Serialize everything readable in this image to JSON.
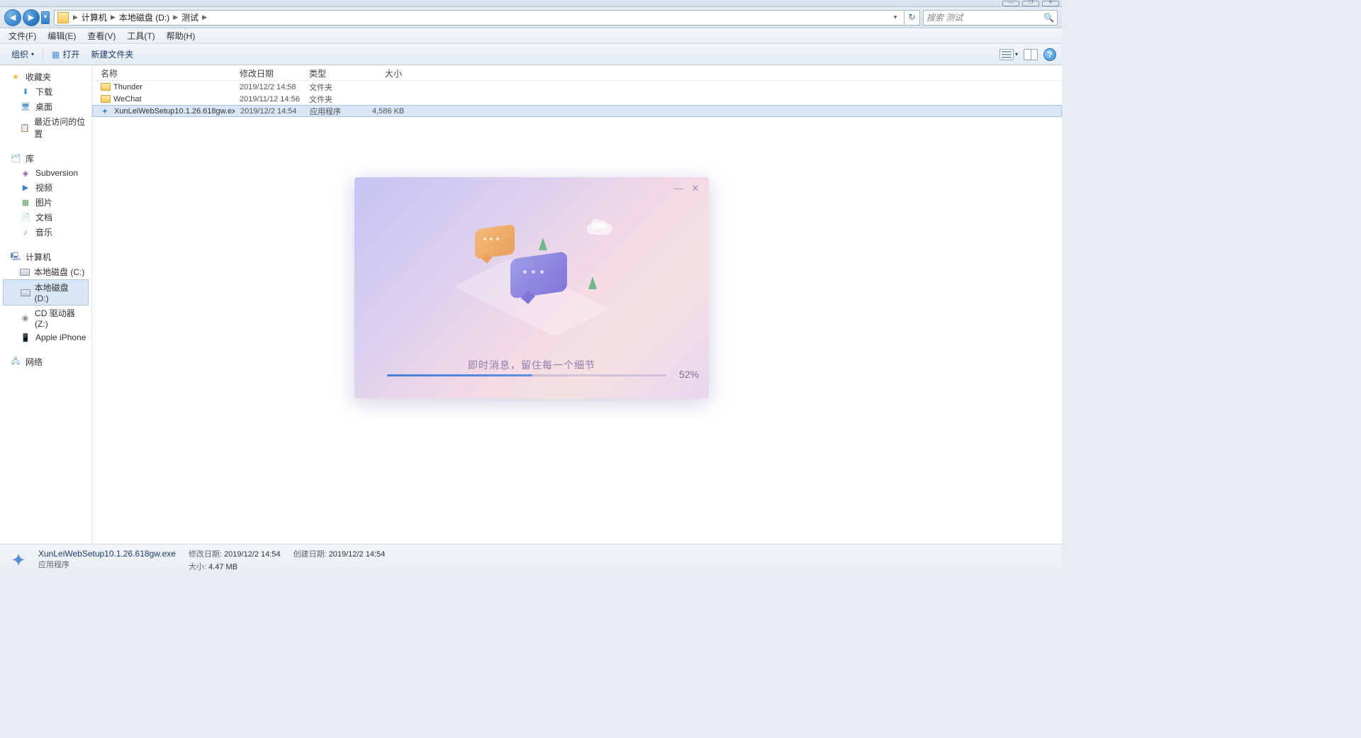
{
  "window_buttons": {
    "min": "—",
    "max": "❐",
    "close": "✕"
  },
  "breadcrumbs": [
    "计算机",
    "本地磁盘 (D:)",
    "测试"
  ],
  "search": {
    "placeholder": "搜索 测试"
  },
  "menu": [
    "文件(F)",
    "编辑(E)",
    "查看(V)",
    "工具(T)",
    "帮助(H)"
  ],
  "toolbar": {
    "organize": "组织",
    "open": "打开",
    "newfolder": "新建文件夹"
  },
  "sidebar": {
    "fav": {
      "head": "收藏夹",
      "items": [
        "下载",
        "桌面",
        "最近访问的位置"
      ]
    },
    "lib": {
      "head": "库",
      "items": [
        "Subversion",
        "视频",
        "图片",
        "文档",
        "音乐"
      ]
    },
    "pc": {
      "head": "计算机",
      "items": [
        "本地磁盘 (C:)",
        "本地磁盘 (D:)",
        "CD 驱动器 (Z:)",
        "Apple iPhone"
      ]
    },
    "net": {
      "head": "网络"
    }
  },
  "columns": {
    "name": "名称",
    "date": "修改日期",
    "type": "类型",
    "size": "大小"
  },
  "files": [
    {
      "name": "Thunder",
      "date": "2019/12/2 14:58",
      "type": "文件夹",
      "size": "",
      "icon": "folder"
    },
    {
      "name": "WeChat",
      "date": "2019/11/12 14:56",
      "type": "文件夹",
      "size": "",
      "icon": "folder"
    },
    {
      "name": "XunLeiWebSetup10.1.26.618gw.exe",
      "date": "2019/12/2 14:54",
      "type": "应用程序",
      "size": "4,586 KB",
      "icon": "exe"
    }
  ],
  "details": {
    "name": "XunLeiWebSetup10.1.26.618gw.exe",
    "type": "应用程序",
    "mod_label": "修改日期:",
    "mod_val": "2019/12/2 14:54",
    "size_label": "大小:",
    "size_val": "4.47 MB",
    "created_label": "创建日期:",
    "created_val": "2019/12/2 14:54"
  },
  "installer": {
    "message": "即时消息，留住每一个细节",
    "percent": "52%",
    "progress": 52
  }
}
